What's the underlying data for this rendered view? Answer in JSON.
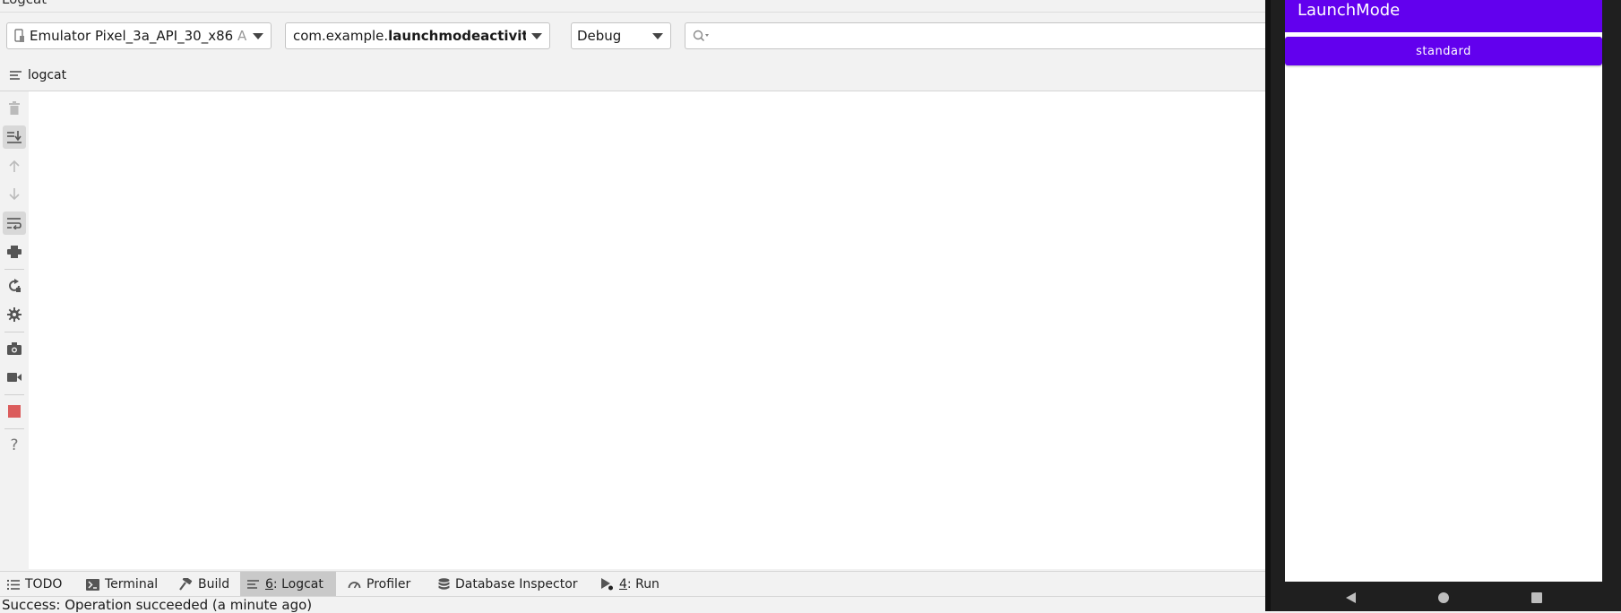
{
  "window": {
    "title": "Logcat"
  },
  "filters": {
    "device": {
      "name": "Emulator Pixel_3a_API_30_x86",
      "suffix": "Ar"
    },
    "package": {
      "prefix": "com.example.",
      "bold": "launchmodeactivity",
      "suffix": "("
    },
    "log_level": "Debug",
    "search": {
      "value": "",
      "placeholder": ""
    }
  },
  "logcat_tab": {
    "label": "logcat"
  },
  "toolbar": {
    "icons": [
      "trash-icon",
      "scroll-to-end-icon",
      "up-arrow-icon",
      "down-arrow-icon",
      "soft-wrap-icon",
      "print-icon",
      "restart-icon",
      "settings-icon",
      "camera-icon",
      "video-icon",
      "stop-icon",
      "help-icon"
    ]
  },
  "bottom_tabs": [
    {
      "label": "TODO",
      "icon": "list-icon"
    },
    {
      "label": "Terminal",
      "icon": "terminal-icon"
    },
    {
      "label": "Build",
      "icon": "hammer-icon"
    },
    {
      "mnemonic": "6",
      "label": ": Logcat",
      "icon": "logcat-icon",
      "active": true
    },
    {
      "label": "Profiler",
      "icon": "gauge-icon"
    },
    {
      "label": "Database Inspector",
      "icon": "database-icon"
    },
    {
      "mnemonic": "4",
      "label": ": Run",
      "icon": "run-icon"
    }
  ],
  "status": {
    "text": "Success: Operation succeeded (a minute ago)"
  },
  "emulator": {
    "app_title": "LaunchMode",
    "button_label": "standard",
    "accent_color": "#6200ee"
  }
}
